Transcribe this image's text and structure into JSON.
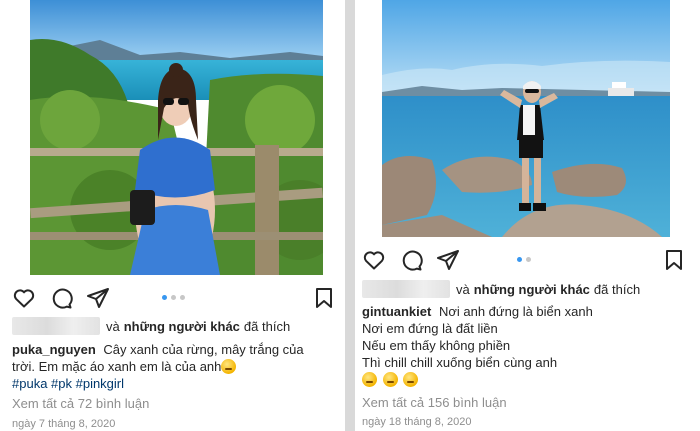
{
  "posts": [
    {
      "username": "puka_nguyen",
      "likes_suffix_pre": "và",
      "likes_bold": "những người khác",
      "likes_suffix_post": "đã thích",
      "caption_lines": [
        "Cây xanh của rừng, mây trắng của",
        "trời. Em mặc áo xanh em là của anh"
      ],
      "hashtags": "#puka #pk #pinkgirl",
      "comments": "Xem tất cả 72 bình luận",
      "date": "ngày 7 tháng 8, 2020",
      "carousel_active": 0,
      "carousel_count": 3
    },
    {
      "username": "gintuankiet",
      "likes_suffix_pre": "và",
      "likes_bold": "những người khác",
      "likes_suffix_post": "đã thích",
      "caption_lines": [
        "Nơi anh đứng là biển xanh",
        "Nơi em đứng là đất liền",
        "Nếu em thấy không phiền",
        "Thì chill chill xuống biển cùng anh"
      ],
      "comments": "Xem tất cả 156 bình luận",
      "date": "ngày 18 tháng 8, 2020",
      "carousel_active": 0,
      "carousel_count": 2
    }
  ],
  "icons": [
    "heart-icon",
    "comment-icon",
    "share-icon",
    "bookmark-icon",
    "emoji-icon"
  ]
}
